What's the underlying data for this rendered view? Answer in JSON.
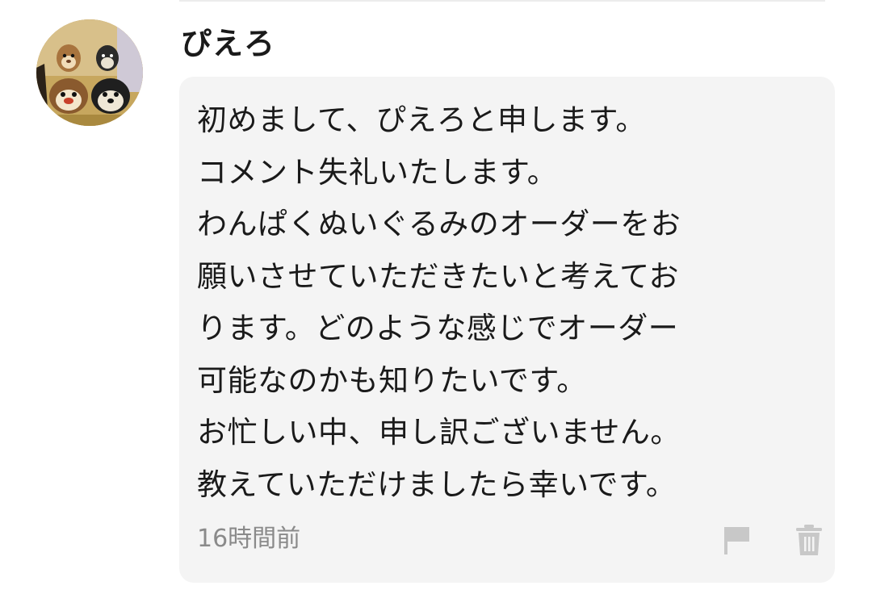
{
  "comment": {
    "avatar_icon": "chipmunk-character-avatar",
    "username": "ぴえろ",
    "body": "初めまして、ぴえろと申します。\nコメント失礼いたします。\nわんぱくぬいぐるみのオーダーをお\n願いさせていただきたいと考えてお\nります。どのような感じでオーダー\n可能なのかも知りたいです。\nお忙しい中、申し訳ございません。\n教えていただけましたら幸いです。",
    "timestamp": "16時間前",
    "actions": {
      "flag_icon": "flag-icon",
      "delete_icon": "trash-icon"
    }
  },
  "colors": {
    "bubble_bg": "#f4f4f4",
    "text": "#1a1a1a",
    "muted": "#8a8a8a",
    "icon": "#c8c8c8"
  }
}
